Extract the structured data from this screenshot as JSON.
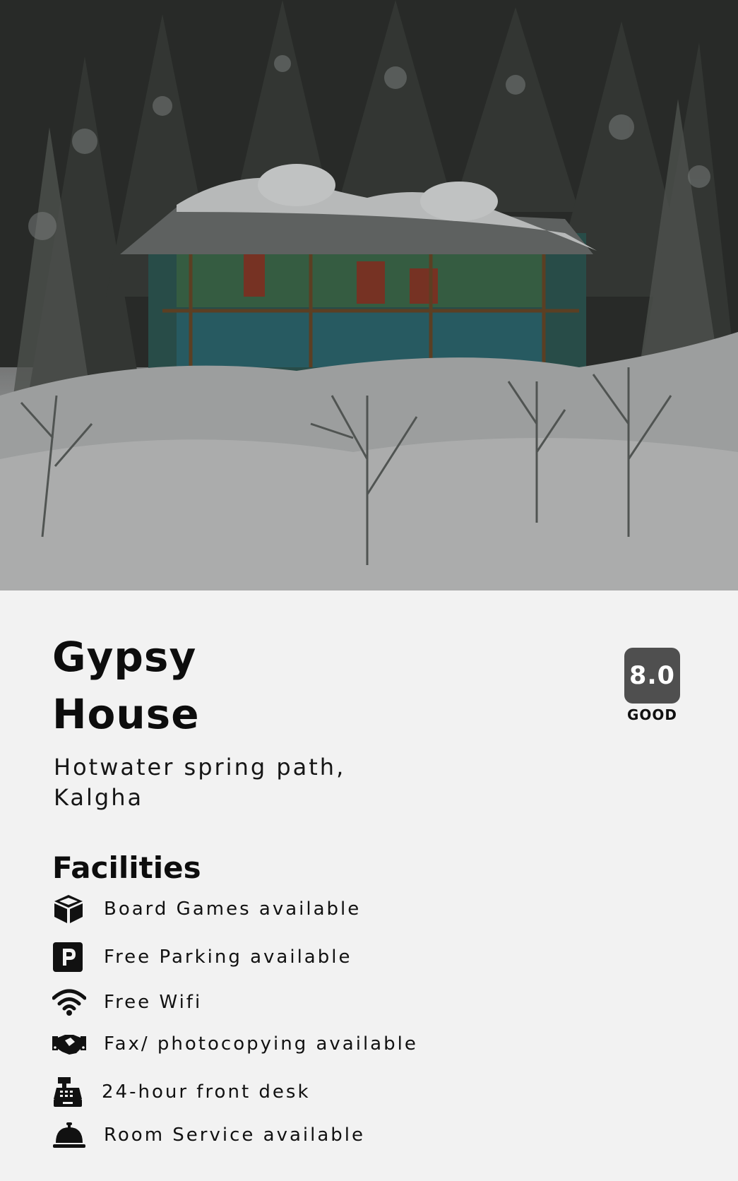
{
  "hotel": {
    "name": "Gypsy House",
    "name_line1": "Gypsy",
    "name_line2": "House",
    "address": "Hotwater spring path, Kalgha",
    "rating_score": "8.0",
    "rating_label": "GOOD",
    "photo_icon": "snowy-guesthouse-photo"
  },
  "facilities": {
    "title": "Facilities",
    "items": [
      {
        "label": "Board Games available",
        "icon": "cube-icon"
      },
      {
        "label": "Free Parking available",
        "icon": "parking-icon"
      },
      {
        "label": "Free Wifi",
        "icon": "wifi-icon"
      },
      {
        "label": "Fax/ photocopying available",
        "icon": "handshake-icon"
      },
      {
        "label": "24-hour front desk",
        "icon": "cash-register-icon"
      },
      {
        "label": "Room Service available",
        "icon": "service-bell-icon"
      }
    ]
  },
  "colors": {
    "background": "#f2f2f2",
    "badge": "#4f4f4f",
    "text": "#111111"
  }
}
